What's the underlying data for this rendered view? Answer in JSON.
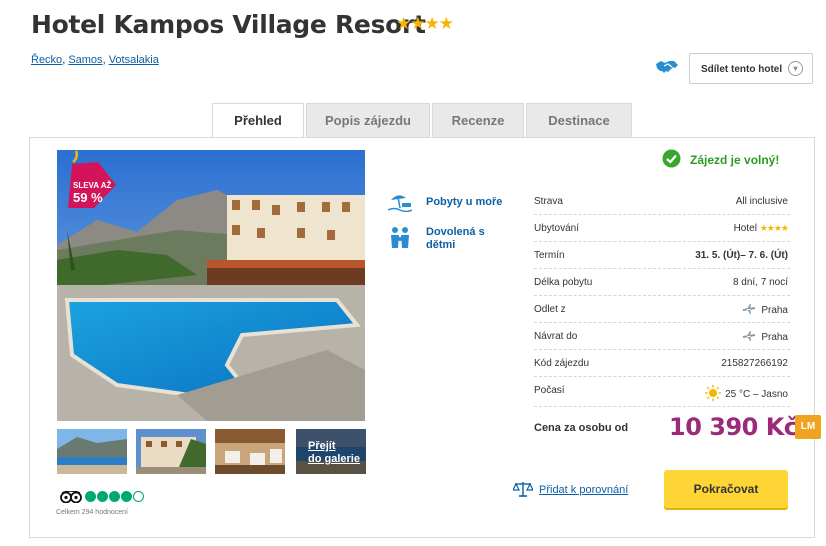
{
  "hotel": {
    "name": "Hotel Kampos Village Resort",
    "stars": 4
  },
  "breadcrumb": {
    "country": "Řecko",
    "island": "Samos",
    "place": "Votsalakia",
    "sep": ", "
  },
  "share": {
    "label": "Sdílet tento hotel"
  },
  "tabs": [
    {
      "label": "Přehled",
      "active": true
    },
    {
      "label": "Popis zájezdu"
    },
    {
      "label": "Recenze"
    },
    {
      "label": "Destinace"
    }
  ],
  "sale_badge": {
    "line1": "SLEVA AŽ",
    "line2": "59 %"
  },
  "gallery": {
    "link": "Přejít do galerie",
    "line1": "Přejít",
    "line2": "do galerie"
  },
  "tripadvisor": {
    "rating": 4,
    "max": 5,
    "count_text": "Celkem 294 hodnocení"
  },
  "features": [
    {
      "icon": "beach-icon",
      "label": "Pobyty u moře"
    },
    {
      "icon": "family-icon",
      "label": "Dovolená s dětmi"
    }
  ],
  "availability": "Zájezd je volný!",
  "details": [
    {
      "label": "Strava",
      "value": "All inclusive"
    },
    {
      "label": "Ubytování",
      "value": "Hotel",
      "stars": 4
    },
    {
      "label": "Termín",
      "value": "31. 5. (Út)– 7. 6. (Út)"
    },
    {
      "label": "Délka pobytu",
      "value": "8 dní, 7 nocí"
    },
    {
      "label": "Odlet z",
      "value": "Praha",
      "icon": "plane-icon"
    },
    {
      "label": "Návrat do",
      "value": "Praha",
      "icon": "plane-icon"
    },
    {
      "label": "Kód zájezdu",
      "value": "215827266192"
    },
    {
      "label": "Počasí",
      "value": "25 °C – Jasno",
      "icon": "sun-icon"
    }
  ],
  "price": {
    "label": "Cena za osobu od",
    "value": "10 390 Kč",
    "badge": "LM"
  },
  "compare": {
    "label": "Přidat k porovnání"
  },
  "cta": {
    "label": "Pokračovat"
  },
  "colors": {
    "accent_blue": "#0b5fa5",
    "price_purple": "#9c2a7a",
    "cta_yellow": "#fdd534",
    "success_green": "#2c9b20",
    "star_gold": "#f7b500"
  }
}
